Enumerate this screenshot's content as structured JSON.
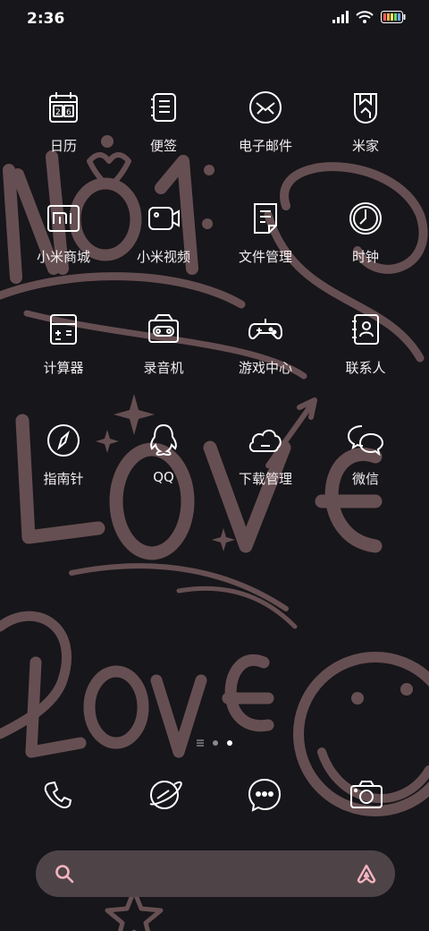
{
  "status_bar": {
    "time": "2:36",
    "icons": [
      "signal-icon",
      "wifi-icon",
      "battery-icon"
    ]
  },
  "wallpaper": {
    "text_1": "No1",
    "text_2": "LOVE",
    "text_3": "Love",
    "stroke_color": "#6e5558"
  },
  "apps": [
    {
      "label": "日历",
      "icon": "calendar-icon",
      "icon_text": "26"
    },
    {
      "label": "便签",
      "icon": "notes-icon"
    },
    {
      "label": "电子邮件",
      "icon": "email-icon"
    },
    {
      "label": "米家",
      "icon": "mijia-icon"
    },
    {
      "label": "小米商城",
      "icon": "mi-store-icon"
    },
    {
      "label": "小米视频",
      "icon": "video-icon"
    },
    {
      "label": "文件管理",
      "icon": "file-manager-icon"
    },
    {
      "label": "时钟",
      "icon": "clock-icon"
    },
    {
      "label": "计算器",
      "icon": "calculator-icon"
    },
    {
      "label": "录音机",
      "icon": "recorder-icon"
    },
    {
      "label": "游戏中心",
      "icon": "game-center-icon"
    },
    {
      "label": "联系人",
      "icon": "contacts-icon"
    },
    {
      "label": "指南针",
      "icon": "compass-icon"
    },
    {
      "label": "QQ",
      "icon": "qq-icon"
    },
    {
      "label": "下载管理",
      "icon": "download-manager-icon"
    },
    {
      "label": "微信",
      "icon": "wechat-icon"
    }
  ],
  "page_indicator": {
    "pages": 2,
    "active": 2
  },
  "dock": [
    {
      "icon": "phone-icon"
    },
    {
      "icon": "browser-icon"
    },
    {
      "icon": "messages-icon"
    },
    {
      "icon": "camera-icon"
    }
  ],
  "search_bar": {
    "icons": [
      "search-icon",
      "assistant-icon"
    ],
    "accent": "#f4b4c0"
  },
  "colors": {
    "background": "#17161a",
    "icon_line": "#ffffff",
    "search_bg": "#4e4447"
  }
}
